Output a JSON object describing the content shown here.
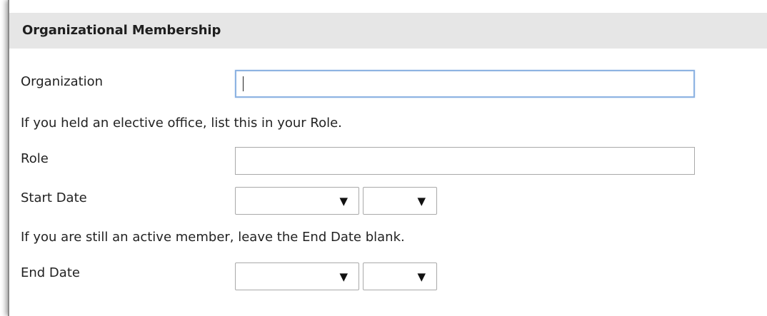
{
  "section": {
    "title": "Organizational Membership"
  },
  "fields": {
    "organization": {
      "label": "Organization",
      "value": ""
    },
    "elective_note": "If you held an elective office, list this in your Role.",
    "role": {
      "label": "Role",
      "value": ""
    },
    "start_date": {
      "label": "Start Date",
      "month": "",
      "year": ""
    },
    "active_note": "If you are still an active member, leave the End Date blank.",
    "end_date": {
      "label": "End Date",
      "month": "",
      "year": ""
    }
  },
  "icons": {
    "dropdown_arrow": "▼"
  },
  "colors": {
    "header_bg": "#e6e6e6",
    "focus_border": "#8db3e2"
  }
}
